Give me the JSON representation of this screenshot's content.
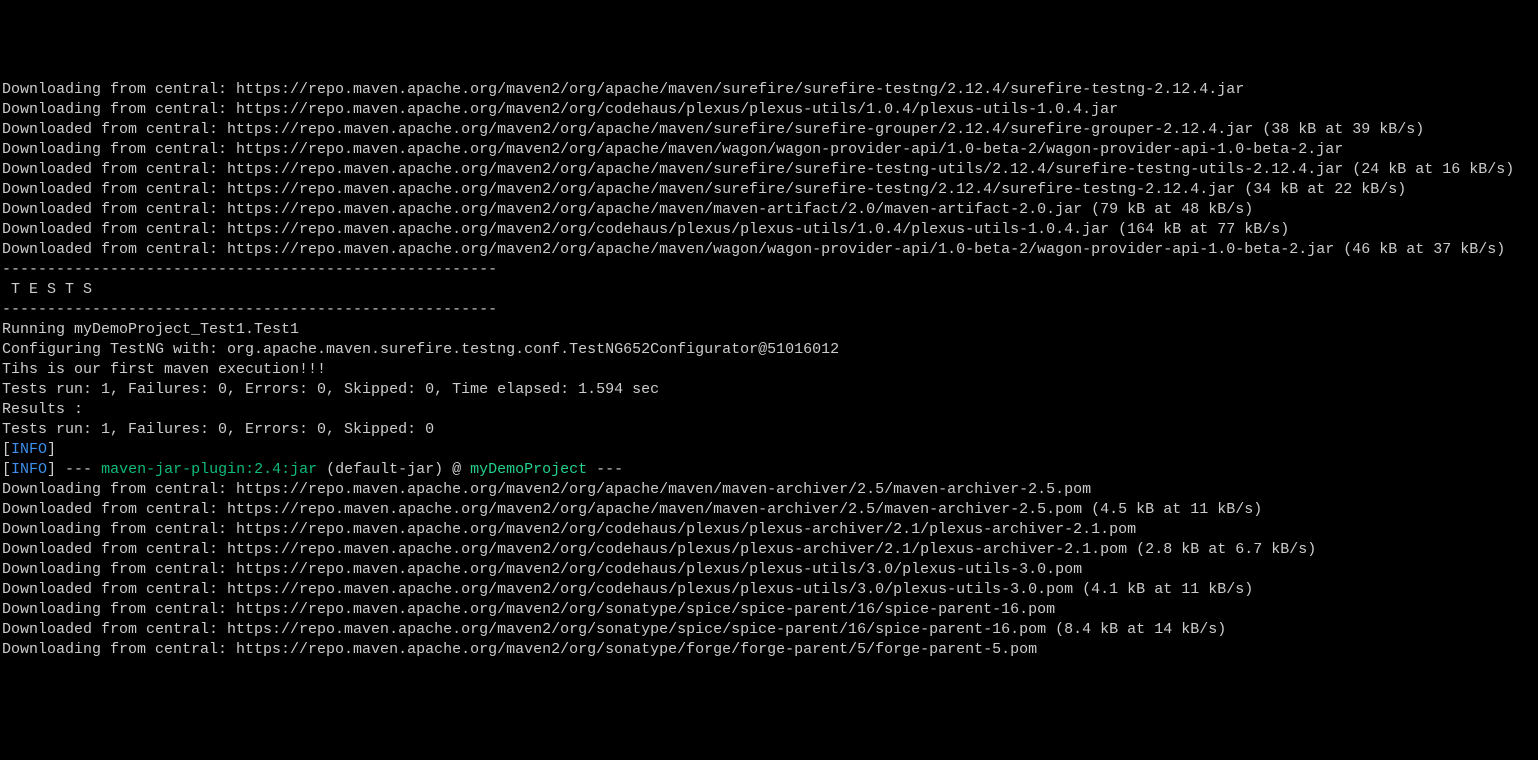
{
  "lines": {
    "l1": "Downloading from central: https://repo.maven.apache.org/maven2/org/apache/maven/surefire/surefire-testng/2.12.4/surefire-testng-2.12.4.jar",
    "l2": "Downloading from central: https://repo.maven.apache.org/maven2/org/codehaus/plexus/plexus-utils/1.0.4/plexus-utils-1.0.4.jar",
    "l3": "Downloaded from central: https://repo.maven.apache.org/maven2/org/apache/maven/surefire/surefire-grouper/2.12.4/surefire-grouper-2.12.4.jar (38 kB at 39 kB/s)",
    "l4": "Downloading from central: https://repo.maven.apache.org/maven2/org/apache/maven/wagon/wagon-provider-api/1.0-beta-2/wagon-provider-api-1.0-beta-2.jar",
    "l5": "Downloaded from central: https://repo.maven.apache.org/maven2/org/apache/maven/surefire/surefire-testng-utils/2.12.4/surefire-testng-utils-2.12.4.jar (24 kB at 16 kB/s)",
    "l6": "Downloaded from central: https://repo.maven.apache.org/maven2/org/apache/maven/surefire/surefire-testng/2.12.4/surefire-testng-2.12.4.jar (34 kB at 22 kB/s)",
    "l7": "Downloaded from central: https://repo.maven.apache.org/maven2/org/apache/maven/maven-artifact/2.0/maven-artifact-2.0.jar (79 kB at 48 kB/s)",
    "l8": "Downloaded from central: https://repo.maven.apache.org/maven2/org/codehaus/plexus/plexus-utils/1.0.4/plexus-utils-1.0.4.jar (164 kB at 77 kB/s)",
    "l9": "Downloaded from central: https://repo.maven.apache.org/maven2/org/apache/maven/wagon/wagon-provider-api/1.0-beta-2/wagon-provider-api-1.0-beta-2.jar (46 kB at 37 kB/s)",
    "blank1": "",
    "sep1": "-------------------------------------------------------",
    "tests_header": " T E S T S",
    "sep2": "-------------------------------------------------------",
    "run1": "Running myDemoProject_Test1.Test1",
    "conf": "Configuring TestNG with: org.apache.maven.surefire.testng.conf.TestNG652Configurator@51016012",
    "msg": "Tihs is our first maven execution!!!",
    "summary1": "Tests run: 1, Failures: 0, Errors: 0, Skipped: 0, Time elapsed: 1.594 sec",
    "blank2": "",
    "results": "Results :",
    "blank3": "",
    "summary2": "Tests run: 1, Failures: 0, Errors: 0, Skipped: 0",
    "blank4": ""
  },
  "info_line1": {
    "open": "[",
    "tag": "INFO",
    "close": "]"
  },
  "info_line2": {
    "open": "[",
    "tag": "INFO",
    "close": "] ",
    "dashes": "--- ",
    "plugin": "maven-jar-plugin:2.4:jar",
    "mid": " (default-jar) @ ",
    "project": "myDemoProject",
    "end": " ---"
  },
  "tail": {
    "t1": "Downloading from central: https://repo.maven.apache.org/maven2/org/apache/maven/maven-archiver/2.5/maven-archiver-2.5.pom",
    "t2": "Downloaded from central: https://repo.maven.apache.org/maven2/org/apache/maven/maven-archiver/2.5/maven-archiver-2.5.pom (4.5 kB at 11 kB/s)",
    "t3": "Downloading from central: https://repo.maven.apache.org/maven2/org/codehaus/plexus/plexus-archiver/2.1/plexus-archiver-2.1.pom",
    "t4": "Downloaded from central: https://repo.maven.apache.org/maven2/org/codehaus/plexus/plexus-archiver/2.1/plexus-archiver-2.1.pom (2.8 kB at 6.7 kB/s)",
    "t5": "Downloading from central: https://repo.maven.apache.org/maven2/org/codehaus/plexus/plexus-utils/3.0/plexus-utils-3.0.pom",
    "t6": "Downloaded from central: https://repo.maven.apache.org/maven2/org/codehaus/plexus/plexus-utils/3.0/plexus-utils-3.0.pom (4.1 kB at 11 kB/s)",
    "t7": "Downloading from central: https://repo.maven.apache.org/maven2/org/sonatype/spice/spice-parent/16/spice-parent-16.pom",
    "t8": "Downloaded from central: https://repo.maven.apache.org/maven2/org/sonatype/spice/spice-parent/16/spice-parent-16.pom (8.4 kB at 14 kB/s)",
    "t9": "Downloading from central: https://repo.maven.apache.org/maven2/org/sonatype/forge/forge-parent/5/forge-parent-5.pom"
  }
}
